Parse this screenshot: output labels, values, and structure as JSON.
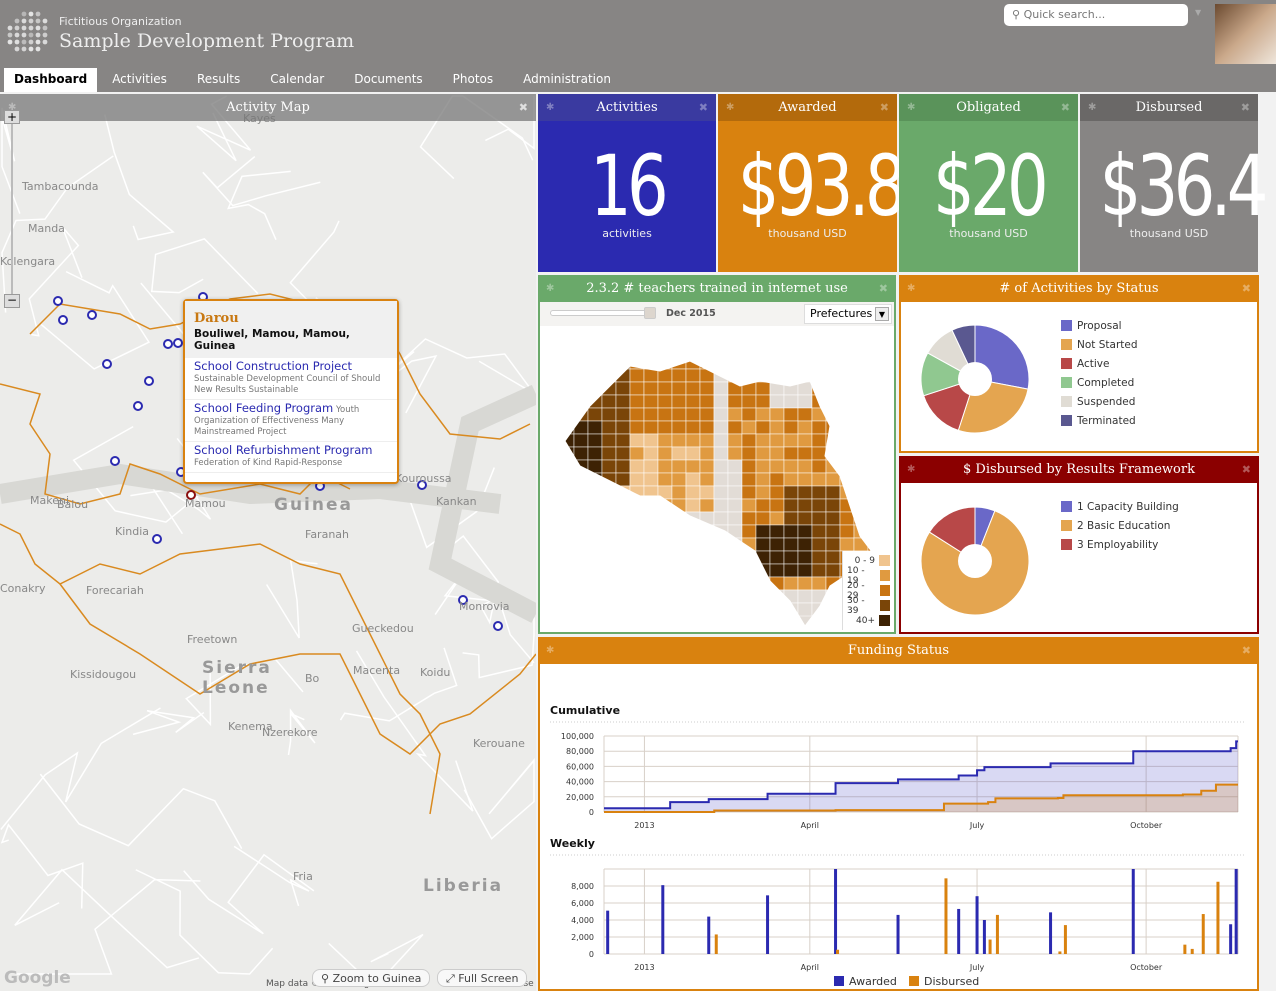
{
  "header": {
    "org": "Fictitious Organization",
    "program": "Sample Development Program",
    "search_placeholder": "Quick search..."
  },
  "nav": [
    {
      "label": "Dashboard",
      "active": true
    },
    {
      "label": "Activities"
    },
    {
      "label": "Results"
    },
    {
      "label": "Calendar"
    },
    {
      "label": "Documents"
    },
    {
      "label": "Photos"
    },
    {
      "label": "Administration"
    }
  ],
  "map": {
    "title": "Activity Map",
    "labels": [
      "Kayes",
      "Tambacounda",
      "Manda",
      "Kolengara",
      "Kindia",
      "Conakry",
      "Forecariah",
      "Mamou",
      "Faranah",
      "Kankan",
      "Kouroussa",
      "Makeni",
      "Freetown",
      "Kissidougou",
      "Gueckedou",
      "Macenta",
      "Koidu",
      "Bo",
      "Kenema",
      "Nzerekore",
      "Kerouane",
      "Monrovia",
      "Fria",
      "Balou"
    ],
    "big_labels": [
      "Guinea",
      "Sierra",
      "Leone",
      "Liberia"
    ],
    "zoom_label": "Zoom to Guinea",
    "fullscreen_label": "Full Screen",
    "attribution": "Map data ©2013 Google   50 km",
    "terms": "Terms of Use",
    "google": "Google",
    "popup": {
      "title": "Darou",
      "location": "Bouliwel, Mamou, Mamou, Guinea",
      "items": [
        {
          "name": "School Construction Project",
          "org": "Sustainable Development Council of Should New Results Sustainable"
        },
        {
          "name": "School Feeding Program",
          "org": "Youth Organization of Effectiveness Many Mainstreamed Project"
        },
        {
          "name": "School Refurbishment Program",
          "org": "Federation of Kind Rapid-Response"
        }
      ]
    }
  },
  "tiles": [
    {
      "title": "Activities",
      "value": "16",
      "unit": "activities",
      "color": "#2b2ab0",
      "head": "#3a3aa0"
    },
    {
      "title": "Awarded",
      "value": "$93.8",
      "unit": "thousand USD",
      "color": "#d9820f",
      "head": "#b36a0c"
    },
    {
      "title": "Obligated",
      "value": "$20",
      "unit": "thousand USD",
      "color": "#6aa96a",
      "head": "#5a935a"
    },
    {
      "title": "Disbursed",
      "value": "$36.4",
      "unit": "thousand USD",
      "color": "#878584",
      "head": "#6a6867"
    }
  ],
  "indicator": {
    "title": "2.3.2 # teachers trained in internet use",
    "date": "Dec 2015",
    "slider_value": 1.0,
    "select": "Prefectures",
    "legend": [
      {
        "label": "0 - 9",
        "color": "#f0c48e"
      },
      {
        "label": "10 - 19",
        "color": "#e09a40"
      },
      {
        "label": "20 - 29",
        "color": "#c87412"
      },
      {
        "label": "30 - 39",
        "color": "#7a4508"
      },
      {
        "label": "40+",
        "color": "#3d2204"
      }
    ]
  },
  "chart_data": [
    {
      "type": "pie",
      "title": "# of Activities by Status",
      "slices": [
        {
          "label": "Proposal",
          "value": 28,
          "color": "#6a68c8"
        },
        {
          "label": "Not Started",
          "value": 27,
          "color": "#e4a550"
        },
        {
          "label": "Active",
          "value": 15,
          "color": "#b84848"
        },
        {
          "label": "Completed",
          "value": 13,
          "color": "#90c890"
        },
        {
          "label": "Suspended",
          "value": 10,
          "color": "#e0dcd4"
        },
        {
          "label": "Terminated",
          "value": 7,
          "color": "#5a5890"
        }
      ]
    },
    {
      "type": "pie",
      "title": "$ Disbursed by Results Framework",
      "slices": [
        {
          "label": "1 Capacity Building",
          "value": 6,
          "color": "#6a68c8"
        },
        {
          "label": "2 Basic Education",
          "value": 78,
          "color": "#e4a550"
        },
        {
          "label": "3 Employability",
          "value": 16,
          "color": "#b84848"
        }
      ]
    },
    {
      "type": "area",
      "title": "Cumulative",
      "xticks": [
        "2013",
        "April",
        "July",
        "October"
      ],
      "ylim": [
        0,
        100000
      ],
      "yticks": [
        "0",
        "20,000",
        "40,000",
        "60,000",
        "80,000",
        "100,000"
      ],
      "series": [
        {
          "name": "Awarded",
          "color": "#2b2ab0",
          "points": [
            [
              "2012-12-10",
              5000
            ],
            [
              "2013-01-15",
              13000
            ],
            [
              "2013-02-05",
              17000
            ],
            [
              "2013-03-09",
              24000
            ],
            [
              "2013-04-15",
              38000
            ],
            [
              "2013-05-19",
              43000
            ],
            [
              "2013-06-21",
              48000
            ],
            [
              "2013-07-01",
              55000
            ],
            [
              "2013-07-05",
              59000
            ],
            [
              "2013-08-10",
              64000
            ],
            [
              "2013-09-24",
              80000
            ],
            [
              "2013-11-16",
              84000
            ],
            [
              "2013-11-19",
              93000
            ]
          ]
        },
        {
          "name": "Disbursed",
          "color": "#d9820f",
          "points": [
            [
              "2012-12-10",
              0
            ],
            [
              "2013-02-08",
              2000
            ],
            [
              "2013-04-15",
              2500
            ],
            [
              "2013-06-13",
              11000
            ],
            [
              "2013-07-07",
              13000
            ],
            [
              "2013-07-11",
              18000
            ],
            [
              "2013-08-14",
              18500
            ],
            [
              "2013-08-17",
              22000
            ],
            [
              "2013-10-21",
              23000
            ],
            [
              "2013-10-31",
              28000
            ],
            [
              "2013-11-08",
              36000
            ]
          ]
        }
      ]
    },
    {
      "type": "bar",
      "title": "Weekly",
      "xticks": [
        "2013",
        "April",
        "July",
        "October"
      ],
      "ylim": [
        0,
        10000
      ],
      "yticks": [
        "0",
        "2,000",
        "4,000",
        "6,000",
        "8,000"
      ],
      "legend": "bottom",
      "series": [
        {
          "name": "Awarded",
          "color": "#2b2ab0",
          "points": [
            [
              "2012-12-12",
              5100
            ],
            [
              "2013-01-11",
              8100
            ],
            [
              "2013-02-05",
              4400
            ],
            [
              "2013-03-09",
              6900
            ],
            [
              "2013-04-15",
              10000
            ],
            [
              "2013-05-19",
              4600
            ],
            [
              "2013-06-21",
              5300
            ],
            [
              "2013-07-01",
              6800
            ],
            [
              "2013-07-05",
              4000
            ],
            [
              "2013-08-10",
              4900
            ],
            [
              "2013-09-24",
              10000
            ],
            [
              "2013-11-16",
              3500
            ],
            [
              "2013-11-19",
              10000
            ]
          ]
        },
        {
          "name": "Disbursed",
          "color": "#d9820f",
          "points": [
            [
              "2013-02-08",
              2300
            ],
            [
              "2013-04-15",
              500
            ],
            [
              "2013-06-13",
              8900
            ],
            [
              "2013-07-07",
              1700
            ],
            [
              "2013-07-11",
              4600
            ],
            [
              "2013-08-14",
              300
            ],
            [
              "2013-08-17",
              3400
            ],
            [
              "2013-10-21",
              1100
            ],
            [
              "2013-10-25",
              600
            ],
            [
              "2013-10-31",
              4700
            ],
            [
              "2013-11-08",
              8500
            ]
          ]
        }
      ]
    }
  ],
  "funding": {
    "title": "Funding Status"
  }
}
